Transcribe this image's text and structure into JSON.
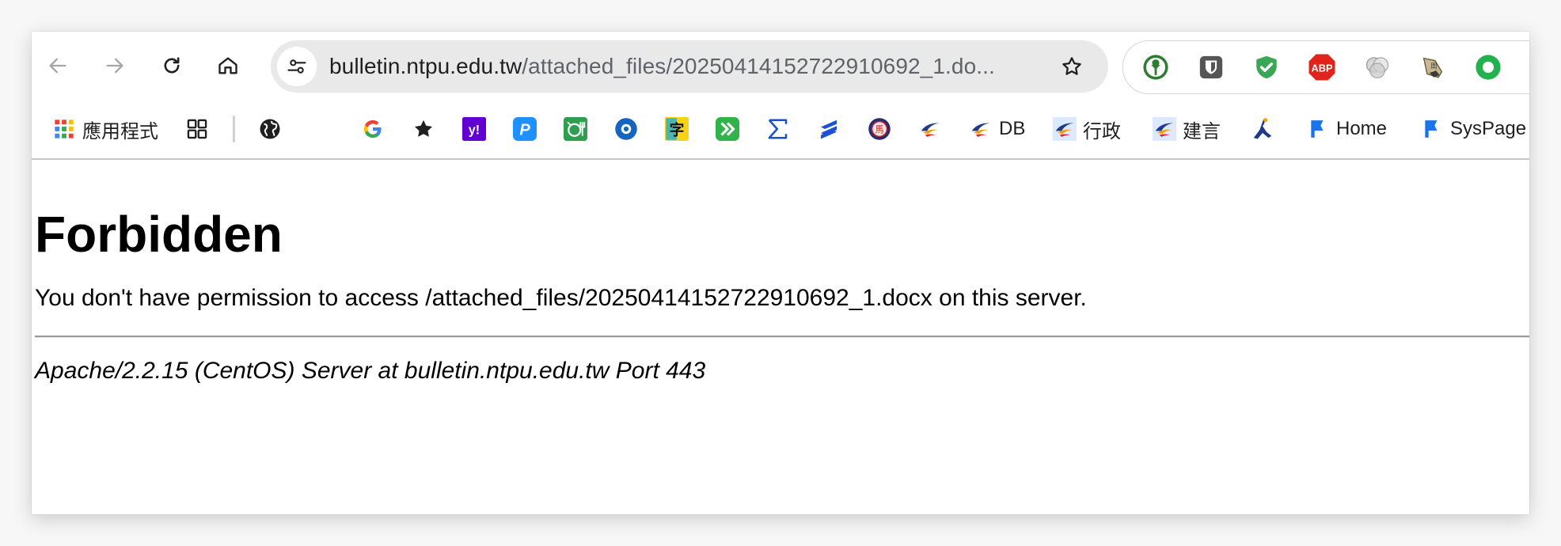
{
  "toolbar": {
    "back_icon": "arrow-left-icon",
    "forward_icon": "arrow-right-icon",
    "reload_icon": "reload-icon",
    "home_icon": "home-icon",
    "site_info_icon": "tune-icon",
    "url_host": "bulletin.ntpu.edu.tw",
    "url_path": "/attached_files/20250414152722910692_1.do...",
    "bookmark_star_icon": "star-outline-icon"
  },
  "extensions": [
    {
      "name": "tree-shield-extension-icon",
      "color": "#2e7d32"
    },
    {
      "name": "bitwarden-shield-icon",
      "color": "#555555"
    },
    {
      "name": "green-shield-check-icon",
      "color": "#3aa757"
    },
    {
      "name": "adblock-plus-icon",
      "label": "ABP",
      "color": "#e0241b"
    },
    {
      "name": "grey-circles-extension-icon",
      "color": "#9e9e9e"
    },
    {
      "name": "dictionary-extension-icon",
      "color": "#8d7a55"
    },
    {
      "name": "green-ring-extension-icon",
      "color": "#22b14c"
    }
  ],
  "bookmarks": {
    "apps_label": "應用程式",
    "items": [
      {
        "icon": "tab-groups-icon",
        "label": ""
      },
      {
        "icon": "globe-icon",
        "label": ""
      },
      {
        "icon": "google-icon",
        "label": ""
      },
      {
        "icon": "star-icon",
        "label": ""
      },
      {
        "icon": "yahoo-icon",
        "label": "y!"
      },
      {
        "icon": "p-icon",
        "label": "P"
      },
      {
        "icon": "restaurant-icon",
        "label": ""
      },
      {
        "icon": "eye-icon",
        "label": ""
      },
      {
        "icon": "dictionary-icon",
        "label": "字"
      },
      {
        "icon": "double-chevron-icon",
        "label": ""
      },
      {
        "icon": "sigma-icon",
        "label": ""
      },
      {
        "icon": "s-stripes-icon",
        "label": ""
      },
      {
        "icon": "seal-icon",
        "label": ""
      },
      {
        "icon": "swoosh-icon",
        "label": ""
      },
      {
        "icon": "swoosh-icon",
        "label": "DB"
      },
      {
        "icon": "swoosh-square-icon",
        "label": "行政"
      },
      {
        "icon": "swoosh-square-icon",
        "label": "建言"
      },
      {
        "icon": "runner-icon",
        "label": ""
      },
      {
        "icon": "flag-icon",
        "label": "Home"
      },
      {
        "icon": "flag-icon",
        "label": "SysPage"
      }
    ]
  },
  "page": {
    "title": "Forbidden",
    "message": "You don't have permission to access /attached_files/20250414152722910692_1.docx on this server.",
    "server_address": "Apache/2.2.15 (CentOS) Server at bulletin.ntpu.edu.tw Port 443"
  },
  "colors": {
    "omnibox_bg": "#e9e9ea",
    "link_blue": "#1a73e8"
  }
}
